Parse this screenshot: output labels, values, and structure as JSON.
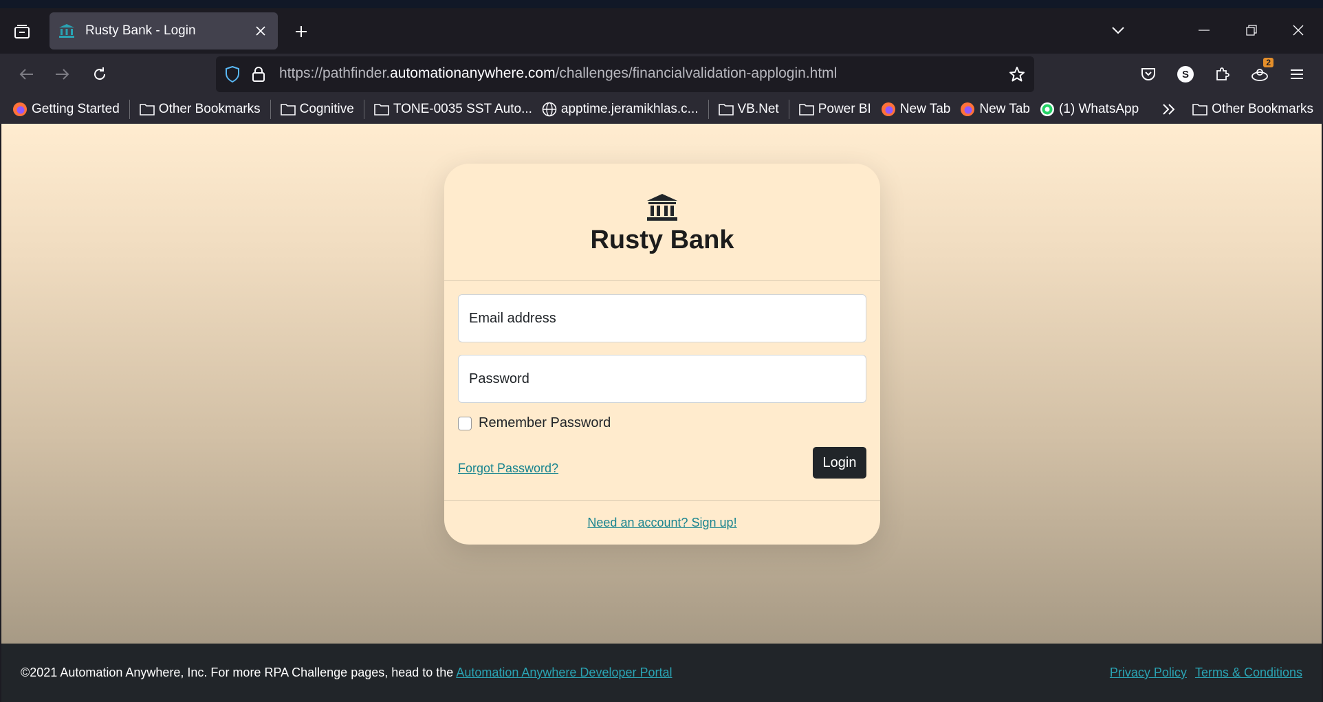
{
  "browser": {
    "tab": {
      "title": "Rusty Bank - Login"
    },
    "url": {
      "prefix": "https://pathfinder.",
      "domain": "automationanywhere.com",
      "path": "/challenges/financialvalidation-applogin.html"
    },
    "extension_badge": "2",
    "profile_initial": "S",
    "bookmarks": [
      {
        "label": "Getting Started",
        "icon": "firefox-icon"
      },
      {
        "label": "Other Bookmarks",
        "icon": "folder-icon"
      },
      {
        "label": "Cognitive",
        "icon": "folder-icon"
      },
      {
        "label": "TONE-0035 SST Auto...",
        "icon": "folder-icon"
      },
      {
        "label": "apptime.jeramikhlas.c...",
        "icon": "globe-icon"
      },
      {
        "label": "VB.Net",
        "icon": "folder-icon"
      },
      {
        "label": "Power BI",
        "icon": "folder-icon"
      },
      {
        "label": "New Tab",
        "icon": "firefox-icon"
      },
      {
        "label": "New Tab",
        "icon": "firefox-icon"
      },
      {
        "label": "(1) WhatsApp",
        "icon": "whatsapp-icon"
      }
    ],
    "bookmarks_right": "Other Bookmarks"
  },
  "login": {
    "brand": "Rusty Bank",
    "email_placeholder": "Email address",
    "password_placeholder": "Password",
    "remember_label": "Remember Password",
    "forgot_link": "Forgot Password?",
    "login_button": "Login",
    "signup_link": "Need an account? Sign up!"
  },
  "footer": {
    "text": "©2021 Automation Anywhere, Inc. For more RPA Challenge pages, head to the ",
    "portal_link": "Automation Anywhere Developer Portal",
    "privacy": "Privacy Policy",
    "terms": "Terms & Conditions"
  },
  "colors": {
    "accent_link": "#19848f",
    "button_dark": "#212529",
    "card_bg": "#ffebcd"
  }
}
